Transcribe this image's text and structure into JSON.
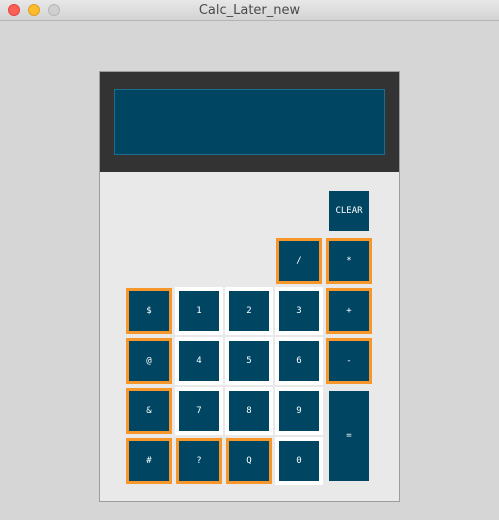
{
  "window": {
    "title": "Calc_Later_new"
  },
  "display": {
    "value": ""
  },
  "keys": {
    "clear": "CLEAR",
    "divide": "/",
    "multiply": "*",
    "dollar": "$",
    "one": "1",
    "two": "2",
    "three": "3",
    "plus": "+",
    "at": "@",
    "four": "4",
    "five": "5",
    "six": "6",
    "minus": "-",
    "ampersand": "&",
    "seven": "7",
    "eight": "8",
    "nine": "9",
    "equals": "=",
    "hash": "#",
    "question": "?",
    "q": "Q",
    "zero": "0"
  },
  "colors": {
    "key_fill": "#004663",
    "key_text": "#ffffff",
    "highlight_orange": "#f7962a",
    "highlight_white": "#ffffff",
    "header_band": "#333333",
    "body_panel": "#e9e9e9",
    "window_bg": "#d6d6d6"
  }
}
